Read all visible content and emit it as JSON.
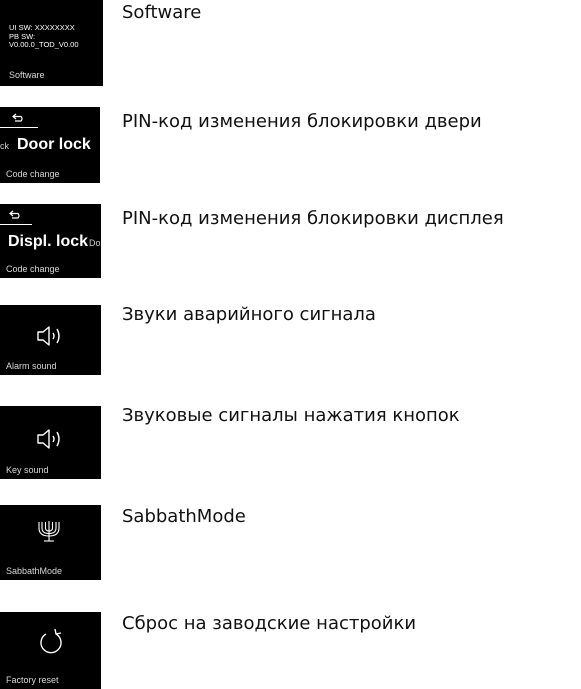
{
  "rows": [
    {
      "description": "Software",
      "screen": {
        "info_lines": [
          "UI SW: XXXXXXXX",
          "PB SW:",
          "V0.00.0_TOD_V0.00"
        ],
        "caption": "Software"
      }
    },
    {
      "description": "PIN-код изменения блокировки двери",
      "screen": {
        "prev_label": "ck",
        "title": "Door lock",
        "caption": "Code change",
        "icon": "back-arrow-icon"
      }
    },
    {
      "description": "PIN-код изменения блокировки дисплея",
      "screen": {
        "title": "Displ. lock",
        "next_label": "Do",
        "caption": "Code change",
        "icon": "back-arrow-icon"
      }
    },
    {
      "description": "Звуки аварийного сигнала",
      "screen": {
        "caption": "Alarm sound",
        "icon": "speaker-icon"
      }
    },
    {
      "description": "Звуковые сигналы нажатия кнопок",
      "screen": {
        "caption": "Key sound",
        "icon": "speaker-icon"
      }
    },
    {
      "description": "SabbathMode",
      "screen": {
        "caption": "SabbathMode",
        "icon": "menorah-icon"
      }
    },
    {
      "description": "Сброс на заводские настройки",
      "screen": {
        "caption": "Factory reset",
        "icon": "reset-icon"
      }
    }
  ]
}
